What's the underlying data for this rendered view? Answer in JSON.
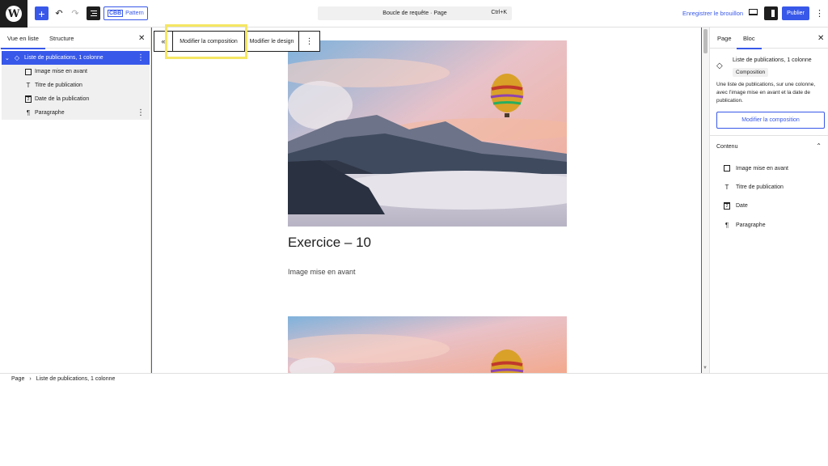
{
  "topbar": {
    "pattern_label": "Pattern",
    "pattern_short": "CBB",
    "command_title": "Boucle de requête · Page",
    "command_shortcut": "Ctrl+K",
    "save_draft_label": "Enregistrer le brouillon",
    "publish_label": "Publier"
  },
  "left_panel": {
    "tabs": [
      "Vue en liste",
      "Structure"
    ],
    "rows": [
      {
        "label": "Liste de publications, 1 colonne"
      },
      {
        "label": "Image mise en avant"
      },
      {
        "label": "Titre de publication"
      },
      {
        "label": "Date de la publication"
      },
      {
        "label": "Paragraphe"
      }
    ]
  },
  "block_toolbar": {
    "edit_composition": "Modifier la composition",
    "edit_design": "Modifier le design"
  },
  "post": {
    "title": "Exercice – 10",
    "paragraph": "Image mise en avant"
  },
  "right_panel": {
    "tabs": [
      "Page",
      "Bloc"
    ],
    "block_title": "Liste de publications, 1 colonne",
    "badge": "Composition",
    "description": "Une liste de publications, sur une colonne, avec l’image mise en avant et la date de publication.",
    "edit_button": "Modifier la composition",
    "section_title": "Contenu",
    "content_items": [
      {
        "label": "Image mise en avant"
      },
      {
        "label": "Titre de publication"
      },
      {
        "label": "Date"
      },
      {
        "label": "Paragraphe"
      }
    ]
  },
  "footer": {
    "crumb_root": "Page",
    "crumb_current": "Liste de publications, 1 colonne"
  },
  "colors": {
    "accent": "#3858e9",
    "highlight": "#f5e663",
    "dark": "#1e1e1e"
  }
}
